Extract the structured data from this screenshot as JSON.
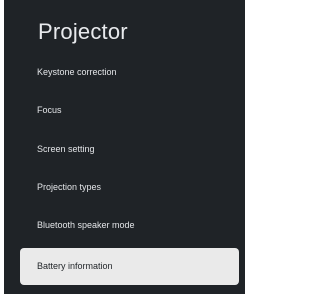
{
  "header": {
    "title": "Projector"
  },
  "menu": {
    "items": [
      {
        "label": "Keystone correction",
        "selected": false
      },
      {
        "label": "Focus",
        "selected": false
      },
      {
        "label": "Screen setting",
        "selected": false
      },
      {
        "label": "Projection types",
        "selected": false
      },
      {
        "label": "Bluetooth speaker mode",
        "selected": false
      },
      {
        "label": "Battery information",
        "selected": true
      }
    ]
  },
  "colors": {
    "panel_background": "#1f2327",
    "text": "#e8eaed",
    "selected_background": "#eaeaea",
    "selected_text": "#1f2327"
  }
}
